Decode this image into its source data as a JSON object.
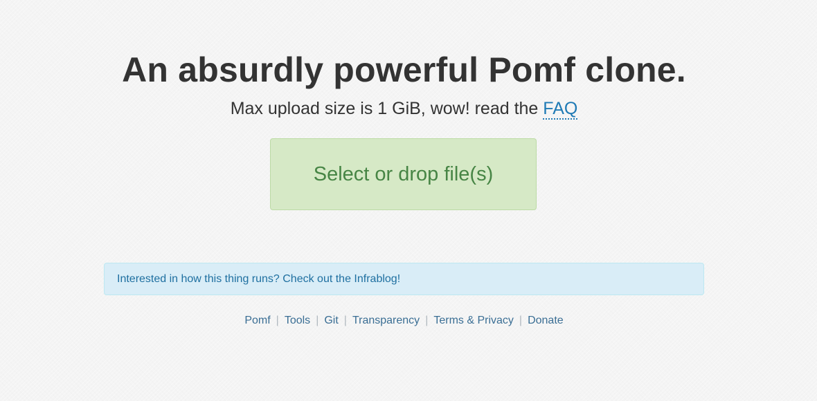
{
  "header": {
    "title": "An absurdly powerful Pomf clone.",
    "subtitle_prefix": "Max upload size is 1 GiB, wow! read the ",
    "faq_link": "FAQ"
  },
  "upload": {
    "button_label": "Select or drop file(s)"
  },
  "alert": {
    "text": "Interested in how this thing runs? Check out the Infrablog!"
  },
  "footer": {
    "links": [
      "Pomf",
      "Tools",
      "Git",
      "Transparency",
      "Terms & Privacy",
      "Donate"
    ],
    "separator": "|"
  },
  "colors": {
    "upload_bg": "#d6e9c6",
    "upload_text": "#478545",
    "alert_bg": "#d9edf7",
    "link": "#1e7ab5"
  }
}
